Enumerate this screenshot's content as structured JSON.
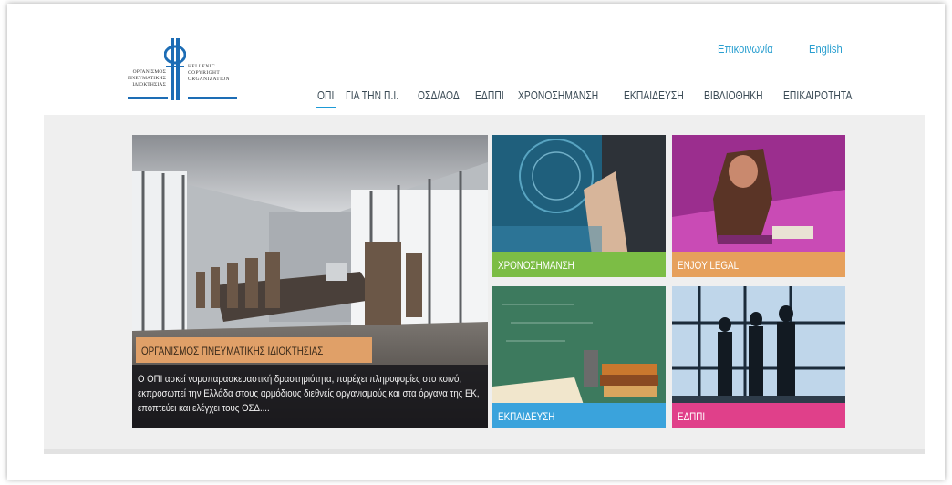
{
  "header": {
    "logo": {
      "left_text": [
        "ΟΡΓΑΝΙΣΜΟΣ",
        "ΠΝΕΥΜΑΤΙΚΗΣ",
        "ΙΔΙΟΚΤΗΣΙΑΣ"
      ],
      "right_text": [
        "HELLENIC",
        "COPYRIGHT",
        "ORGANIZATION"
      ],
      "mark": "opi-logo-mark"
    },
    "top_links": {
      "contact": "Επικοινωνία",
      "english": "English"
    },
    "nav": [
      "ΟΠΙ",
      "ΓΙΑ ΤΗΝ Π.Ι.",
      "ΟΣΔ/ΑΟΔ",
      "ΕΔΠΠΙ",
      "ΧΡΟΝΟΣΗΜΑΝΣΗ",
      "ΕΚΠΑΙΔΕΥΣΗ",
      "ΒΙΒΛΙΟΘΗΚΗ",
      "ΕΠΙΚΑΙΡΟΤΗΤΑ"
    ],
    "nav_active": "ΟΠΙ"
  },
  "featured": {
    "title": "ΟΡΓΑΝΙΣΜΟΣ ΠΝΕΥΜΑΤΙΚΗΣ ΙΔΙΟΚΤΗΣΙΑΣ",
    "description": "Ο ΟΠΙ ασκεί νομοπαρασκευαστική δραστηριότητα, παρέχει πληροφορίες στο κοινό, εκπροσωπεί την Ελλάδα στους αρμόδιους διεθνείς οργανισμούς και στα όργανα της ΕΚ, εποπτεύει και ελέγχει τους ΟΣΔ....",
    "image": "conference-room-photo"
  },
  "tiles": [
    {
      "label": "ΧΡΟΝΟΣΗΜΑΝΣΗ",
      "image": "touchscreen-photo",
      "color": "#7cbd45"
    },
    {
      "label": "ENJOY LEGAL",
      "image": "stressed-woman-photo",
      "color": "#e6a05c"
    },
    {
      "label": "ΕΚΠΑΙΔΕΥΣΗ",
      "image": "books-chalkboard-photo",
      "color": "#3aa3dc"
    },
    {
      "label": "ΕΔΠΠΙ",
      "image": "business-silhouettes-photo",
      "color": "#e0408a"
    }
  ],
  "colors": {
    "accent": "#1d9ad6",
    "link": "#2a9fd0"
  }
}
